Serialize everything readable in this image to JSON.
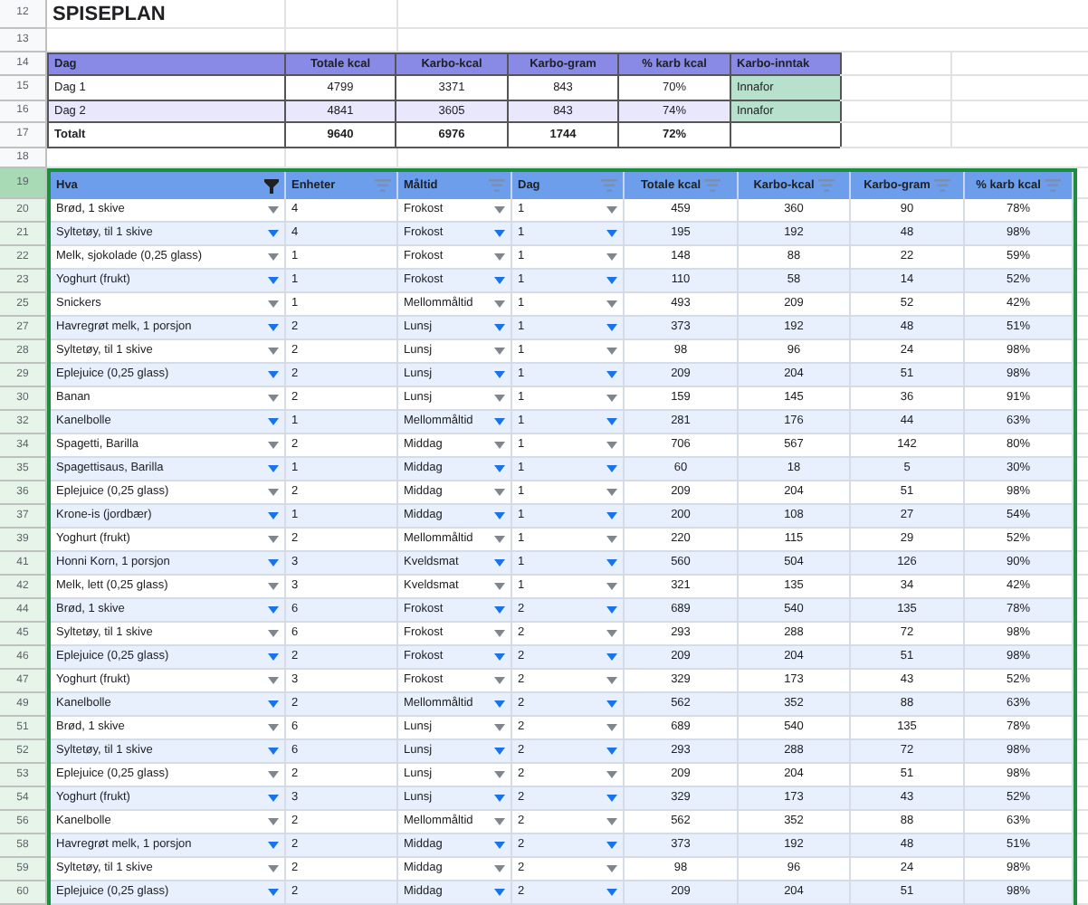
{
  "title_row": {
    "row_number": "12",
    "title": "SPISEPLAN"
  },
  "summary": {
    "spacer_row_number": "13",
    "header_row_number": "14",
    "after_row_number": "18",
    "columns": [
      "Dag",
      "Totale kcal",
      "Karbo-kcal",
      "Karbo-gram",
      "% karb kcal",
      "Karbo-inntak"
    ],
    "rows": [
      {
        "row_number": "15",
        "kind": "day",
        "banded": false,
        "color": "#b7e1cd",
        "cells": [
          "Dag 1",
          "4799",
          "3371",
          "843",
          "70%",
          "Innafor"
        ]
      },
      {
        "row_number": "16",
        "kind": "day",
        "banded": true,
        "color": "#b7e1cd",
        "cells": [
          "Dag 2",
          "4841",
          "3605",
          "843",
          "74%",
          "Innafor"
        ]
      },
      {
        "row_number": "17",
        "kind": "total",
        "banded": false,
        "cells": [
          "Totalt",
          "9640",
          "6976",
          "1744",
          "72%"
        ]
      }
    ]
  },
  "filter_table": {
    "header_row_number": "19",
    "columns": [
      {
        "label": "Hva",
        "kind": "dropdown",
        "filter_active": true
      },
      {
        "label": "Enheter",
        "kind": "text",
        "filter_active": false
      },
      {
        "label": "Måltid",
        "kind": "dropdown",
        "filter_active": false
      },
      {
        "label": "Dag",
        "kind": "dropdown",
        "filter_active": false
      },
      {
        "label": "Totale kcal",
        "kind": "number",
        "filter_active": false
      },
      {
        "label": "Karbo-kcal",
        "kind": "number",
        "filter_active": false
      },
      {
        "label": "Karbo-gram",
        "kind": "number",
        "filter_active": false
      },
      {
        "label": "% karb kcal",
        "kind": "number",
        "filter_active": false
      }
    ],
    "rows": [
      {
        "row_number": "20",
        "cells": [
          "Brød, 1 skive",
          "4",
          "Frokost",
          "1",
          "459",
          "360",
          "90",
          "78%"
        ]
      },
      {
        "row_number": "21",
        "cells": [
          "Syltetøy, til 1 skive",
          "4",
          "Frokost",
          "1",
          "195",
          "192",
          "48",
          "98%"
        ]
      },
      {
        "row_number": "22",
        "cells": [
          "Melk, sjokolade (0,25 glass)",
          "1",
          "Frokost",
          "1",
          "148",
          "88",
          "22",
          "59%"
        ]
      },
      {
        "row_number": "23",
        "cells": [
          "Yoghurt (frukt)",
          "1",
          "Frokost",
          "1",
          "110",
          "58",
          "14",
          "52%"
        ]
      },
      {
        "row_number": "25",
        "cells": [
          "Snickers",
          "1",
          "Mellommåltid",
          "1",
          "493",
          "209",
          "52",
          "42%"
        ]
      },
      {
        "row_number": "27",
        "cells": [
          "Havregrøt melk, 1 porsjon",
          "2",
          "Lunsj",
          "1",
          "373",
          "192",
          "48",
          "51%"
        ]
      },
      {
        "row_number": "28",
        "cells": [
          "Syltetøy, til 1 skive",
          "2",
          "Lunsj",
          "1",
          "98",
          "96",
          "24",
          "98%"
        ]
      },
      {
        "row_number": "29",
        "cells": [
          "Eplejuice (0,25 glass)",
          "2",
          "Lunsj",
          "1",
          "209",
          "204",
          "51",
          "98%"
        ]
      },
      {
        "row_number": "30",
        "cells": [
          "Banan",
          "2",
          "Lunsj",
          "1",
          "159",
          "145",
          "36",
          "91%"
        ]
      },
      {
        "row_number": "32",
        "cells": [
          "Kanelbolle",
          "1",
          "Mellommåltid",
          "1",
          "281",
          "176",
          "44",
          "63%"
        ]
      },
      {
        "row_number": "34",
        "cells": [
          "Spagetti, Barilla",
          "2",
          "Middag",
          "1",
          "706",
          "567",
          "142",
          "80%"
        ]
      },
      {
        "row_number": "35",
        "cells": [
          "Spagettisaus, Barilla",
          "1",
          "Middag",
          "1",
          "60",
          "18",
          "5",
          "30%"
        ]
      },
      {
        "row_number": "36",
        "cells": [
          "Eplejuice (0,25 glass)",
          "2",
          "Middag",
          "1",
          "209",
          "204",
          "51",
          "98%"
        ]
      },
      {
        "row_number": "37",
        "cells": [
          "Krone-is (jordbær)",
          "1",
          "Middag",
          "1",
          "200",
          "108",
          "27",
          "54%"
        ]
      },
      {
        "row_number": "39",
        "cells": [
          "Yoghurt (frukt)",
          "2",
          "Mellommåltid",
          "1",
          "220",
          "115",
          "29",
          "52%"
        ]
      },
      {
        "row_number": "41",
        "cells": [
          "Honni Korn, 1 porsjon",
          "3",
          "Kveldsmat",
          "1",
          "560",
          "504",
          "126",
          "90%"
        ]
      },
      {
        "row_number": "42",
        "cells": [
          "Melk, lett (0,25 glass)",
          "3",
          "Kveldsmat",
          "1",
          "321",
          "135",
          "34",
          "42%"
        ]
      },
      {
        "row_number": "44",
        "cells": [
          "Brød, 1 skive",
          "6",
          "Frokost",
          "2",
          "689",
          "540",
          "135",
          "78%"
        ]
      },
      {
        "row_number": "45",
        "cells": [
          "Syltetøy, til 1 skive",
          "6",
          "Frokost",
          "2",
          "293",
          "288",
          "72",
          "98%"
        ]
      },
      {
        "row_number": "46",
        "cells": [
          "Eplejuice (0,25 glass)",
          "2",
          "Frokost",
          "2",
          "209",
          "204",
          "51",
          "98%"
        ]
      },
      {
        "row_number": "47",
        "cells": [
          "Yoghurt (frukt)",
          "3",
          "Frokost",
          "2",
          "329",
          "173",
          "43",
          "52%"
        ]
      },
      {
        "row_number": "49",
        "cells": [
          "Kanelbolle",
          "2",
          "Mellommåltid",
          "2",
          "562",
          "352",
          "88",
          "63%"
        ]
      },
      {
        "row_number": "51",
        "cells": [
          "Brød, 1 skive",
          "6",
          "Lunsj",
          "2",
          "689",
          "540",
          "135",
          "78%"
        ]
      },
      {
        "row_number": "52",
        "cells": [
          "Syltetøy, til 1 skive",
          "6",
          "Lunsj",
          "2",
          "293",
          "288",
          "72",
          "98%"
        ]
      },
      {
        "row_number": "53",
        "cells": [
          "Eplejuice (0,25 glass)",
          "2",
          "Lunsj",
          "2",
          "209",
          "204",
          "51",
          "98%"
        ]
      },
      {
        "row_number": "54",
        "cells": [
          "Yoghurt (frukt)",
          "3",
          "Lunsj",
          "2",
          "329",
          "173",
          "43",
          "52%"
        ]
      },
      {
        "row_number": "56",
        "cells": [
          "Kanelbolle",
          "2",
          "Mellommåltid",
          "2",
          "562",
          "352",
          "88",
          "63%"
        ]
      },
      {
        "row_number": "58",
        "cells": [
          "Havregrøt melk, 1 porsjon",
          "2",
          "Middag",
          "2",
          "373",
          "192",
          "48",
          "51%"
        ]
      },
      {
        "row_number": "59",
        "cells": [
          "Syltetøy, til 1 skive",
          "2",
          "Middag",
          "2",
          "98",
          "96",
          "24",
          "98%"
        ]
      },
      {
        "row_number": "60",
        "cells": [
          "Eplejuice (0,25 glass)",
          "2",
          "Middag",
          "2",
          "209",
          "204",
          "51",
          "98%"
        ]
      }
    ]
  }
}
